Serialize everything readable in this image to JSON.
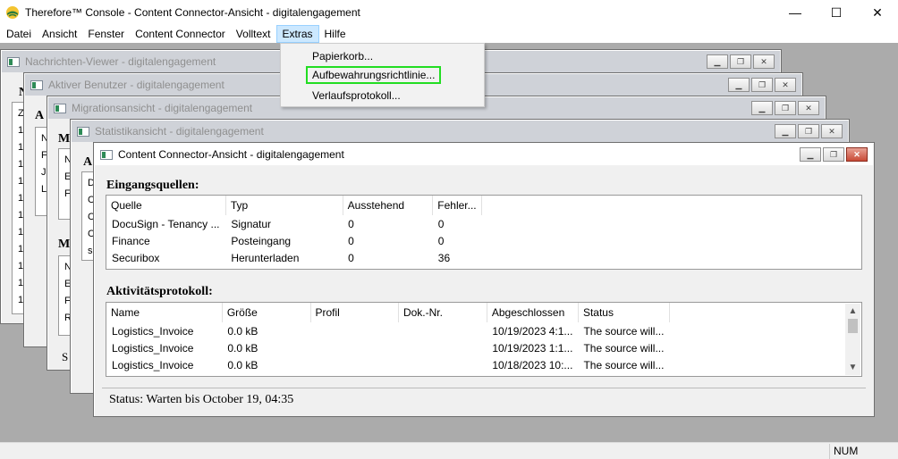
{
  "app": {
    "title": "Therefore™ Console - Content Connector-Ansicht - digitalengagement",
    "controls": {
      "minimize": "—",
      "maximize": "☐",
      "close": "✕"
    }
  },
  "menu": [
    "Datei",
    "Ansicht",
    "Fenster",
    "Content Connector",
    "Volltext",
    "Extras",
    "Hilfe"
  ],
  "extras_menu": [
    "Papierkorb...",
    "Aufbewahrungsrichtlinie...",
    "Verlaufsprotokoll..."
  ],
  "windows": [
    {
      "title": "Nachrichten-Viewer - digitalengagement",
      "stub": "N",
      "lines": [
        "Z",
        "1",
        "1",
        "1",
        "1",
        "1",
        "1",
        "1",
        "1",
        "1",
        "1",
        "1"
      ]
    },
    {
      "title": "Aktiver Benutzer - digitalengagement",
      "stub": "A",
      "lines": [
        "N",
        "F",
        "J",
        "L"
      ]
    },
    {
      "title": "Migrationsansicht - digitalengagement",
      "stub": "M",
      "lines": [
        "N",
        "E",
        "F",
        "M",
        "N",
        "E",
        "F",
        "R"
      ],
      "stub2": "M",
      "foot": "S"
    },
    {
      "title": "Statistikansicht - digitalengagement",
      "stub": "A",
      "lines": [
        "D",
        "C",
        "C",
        "C",
        "s"
      ]
    }
  ],
  "active_window": {
    "title": "Content Connector-Ansicht - digitalengagement",
    "sources_heading": "Eingangsquellen:",
    "sources_columns": [
      "Quelle",
      "Typ",
      "Ausstehend",
      "Fehler..."
    ],
    "sources_rows": [
      [
        "DocuSign - Tenancy ...",
        "Signatur",
        "0",
        "0"
      ],
      [
        "Finance",
        "Posteingang",
        "0",
        "0"
      ],
      [
        "Securibox",
        "Herunterladen",
        "0",
        "36"
      ]
    ],
    "log_heading": "Aktivitätsprotokoll:",
    "log_columns": [
      "Name",
      "Größe",
      "Profil",
      "Dok.-Nr.",
      "Abgeschlossen",
      "Status"
    ],
    "log_rows": [
      [
        "Logistics_Invoice",
        "0.0 kB",
        "",
        "",
        "10/19/2023 4:1...",
        "The source will..."
      ],
      [
        "Logistics_Invoice",
        "0.0 kB",
        "",
        "",
        "10/19/2023 1:1...",
        "The source will..."
      ],
      [
        "Logistics_Invoice",
        "0.0 kB",
        "",
        "",
        "10/18/2023 10:...",
        "The source will..."
      ]
    ],
    "status": "Status: Warten bis October 19, 04:35"
  },
  "statusbar": {
    "num": "NUM"
  }
}
